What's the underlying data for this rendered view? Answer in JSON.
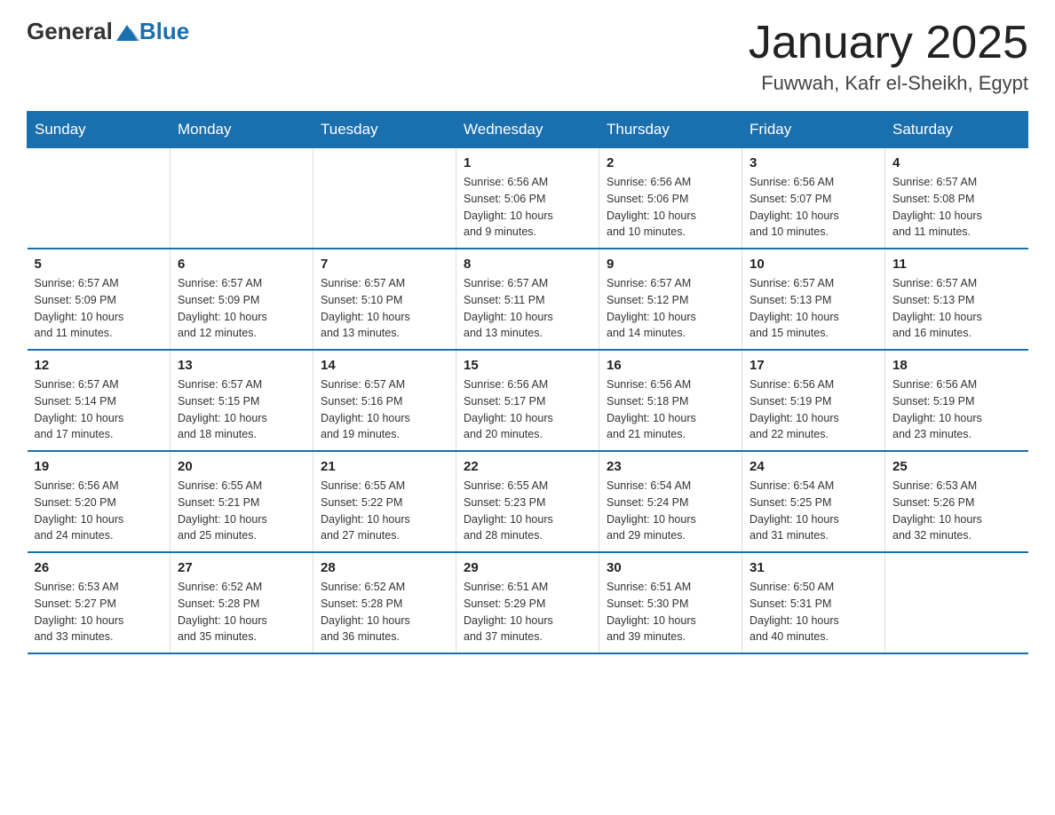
{
  "logo": {
    "text_general": "General",
    "text_blue": "Blue"
  },
  "title": "January 2025",
  "subtitle": "Fuwwah, Kafr el-Sheikh, Egypt",
  "headers": [
    "Sunday",
    "Monday",
    "Tuesday",
    "Wednesday",
    "Thursday",
    "Friday",
    "Saturday"
  ],
  "weeks": [
    [
      {
        "day": "",
        "info": ""
      },
      {
        "day": "",
        "info": ""
      },
      {
        "day": "",
        "info": ""
      },
      {
        "day": "1",
        "info": "Sunrise: 6:56 AM\nSunset: 5:06 PM\nDaylight: 10 hours\nand 9 minutes."
      },
      {
        "day": "2",
        "info": "Sunrise: 6:56 AM\nSunset: 5:06 PM\nDaylight: 10 hours\nand 10 minutes."
      },
      {
        "day": "3",
        "info": "Sunrise: 6:56 AM\nSunset: 5:07 PM\nDaylight: 10 hours\nand 10 minutes."
      },
      {
        "day": "4",
        "info": "Sunrise: 6:57 AM\nSunset: 5:08 PM\nDaylight: 10 hours\nand 11 minutes."
      }
    ],
    [
      {
        "day": "5",
        "info": "Sunrise: 6:57 AM\nSunset: 5:09 PM\nDaylight: 10 hours\nand 11 minutes."
      },
      {
        "day": "6",
        "info": "Sunrise: 6:57 AM\nSunset: 5:09 PM\nDaylight: 10 hours\nand 12 minutes."
      },
      {
        "day": "7",
        "info": "Sunrise: 6:57 AM\nSunset: 5:10 PM\nDaylight: 10 hours\nand 13 minutes."
      },
      {
        "day": "8",
        "info": "Sunrise: 6:57 AM\nSunset: 5:11 PM\nDaylight: 10 hours\nand 13 minutes."
      },
      {
        "day": "9",
        "info": "Sunrise: 6:57 AM\nSunset: 5:12 PM\nDaylight: 10 hours\nand 14 minutes."
      },
      {
        "day": "10",
        "info": "Sunrise: 6:57 AM\nSunset: 5:13 PM\nDaylight: 10 hours\nand 15 minutes."
      },
      {
        "day": "11",
        "info": "Sunrise: 6:57 AM\nSunset: 5:13 PM\nDaylight: 10 hours\nand 16 minutes."
      }
    ],
    [
      {
        "day": "12",
        "info": "Sunrise: 6:57 AM\nSunset: 5:14 PM\nDaylight: 10 hours\nand 17 minutes."
      },
      {
        "day": "13",
        "info": "Sunrise: 6:57 AM\nSunset: 5:15 PM\nDaylight: 10 hours\nand 18 minutes."
      },
      {
        "day": "14",
        "info": "Sunrise: 6:57 AM\nSunset: 5:16 PM\nDaylight: 10 hours\nand 19 minutes."
      },
      {
        "day": "15",
        "info": "Sunrise: 6:56 AM\nSunset: 5:17 PM\nDaylight: 10 hours\nand 20 minutes."
      },
      {
        "day": "16",
        "info": "Sunrise: 6:56 AM\nSunset: 5:18 PM\nDaylight: 10 hours\nand 21 minutes."
      },
      {
        "day": "17",
        "info": "Sunrise: 6:56 AM\nSunset: 5:19 PM\nDaylight: 10 hours\nand 22 minutes."
      },
      {
        "day": "18",
        "info": "Sunrise: 6:56 AM\nSunset: 5:19 PM\nDaylight: 10 hours\nand 23 minutes."
      }
    ],
    [
      {
        "day": "19",
        "info": "Sunrise: 6:56 AM\nSunset: 5:20 PM\nDaylight: 10 hours\nand 24 minutes."
      },
      {
        "day": "20",
        "info": "Sunrise: 6:55 AM\nSunset: 5:21 PM\nDaylight: 10 hours\nand 25 minutes."
      },
      {
        "day": "21",
        "info": "Sunrise: 6:55 AM\nSunset: 5:22 PM\nDaylight: 10 hours\nand 27 minutes."
      },
      {
        "day": "22",
        "info": "Sunrise: 6:55 AM\nSunset: 5:23 PM\nDaylight: 10 hours\nand 28 minutes."
      },
      {
        "day": "23",
        "info": "Sunrise: 6:54 AM\nSunset: 5:24 PM\nDaylight: 10 hours\nand 29 minutes."
      },
      {
        "day": "24",
        "info": "Sunrise: 6:54 AM\nSunset: 5:25 PM\nDaylight: 10 hours\nand 31 minutes."
      },
      {
        "day": "25",
        "info": "Sunrise: 6:53 AM\nSunset: 5:26 PM\nDaylight: 10 hours\nand 32 minutes."
      }
    ],
    [
      {
        "day": "26",
        "info": "Sunrise: 6:53 AM\nSunset: 5:27 PM\nDaylight: 10 hours\nand 33 minutes."
      },
      {
        "day": "27",
        "info": "Sunrise: 6:52 AM\nSunset: 5:28 PM\nDaylight: 10 hours\nand 35 minutes."
      },
      {
        "day": "28",
        "info": "Sunrise: 6:52 AM\nSunset: 5:28 PM\nDaylight: 10 hours\nand 36 minutes."
      },
      {
        "day": "29",
        "info": "Sunrise: 6:51 AM\nSunset: 5:29 PM\nDaylight: 10 hours\nand 37 minutes."
      },
      {
        "day": "30",
        "info": "Sunrise: 6:51 AM\nSunset: 5:30 PM\nDaylight: 10 hours\nand 39 minutes."
      },
      {
        "day": "31",
        "info": "Sunrise: 6:50 AM\nSunset: 5:31 PM\nDaylight: 10 hours\nand 40 minutes."
      },
      {
        "day": "",
        "info": ""
      }
    ]
  ]
}
